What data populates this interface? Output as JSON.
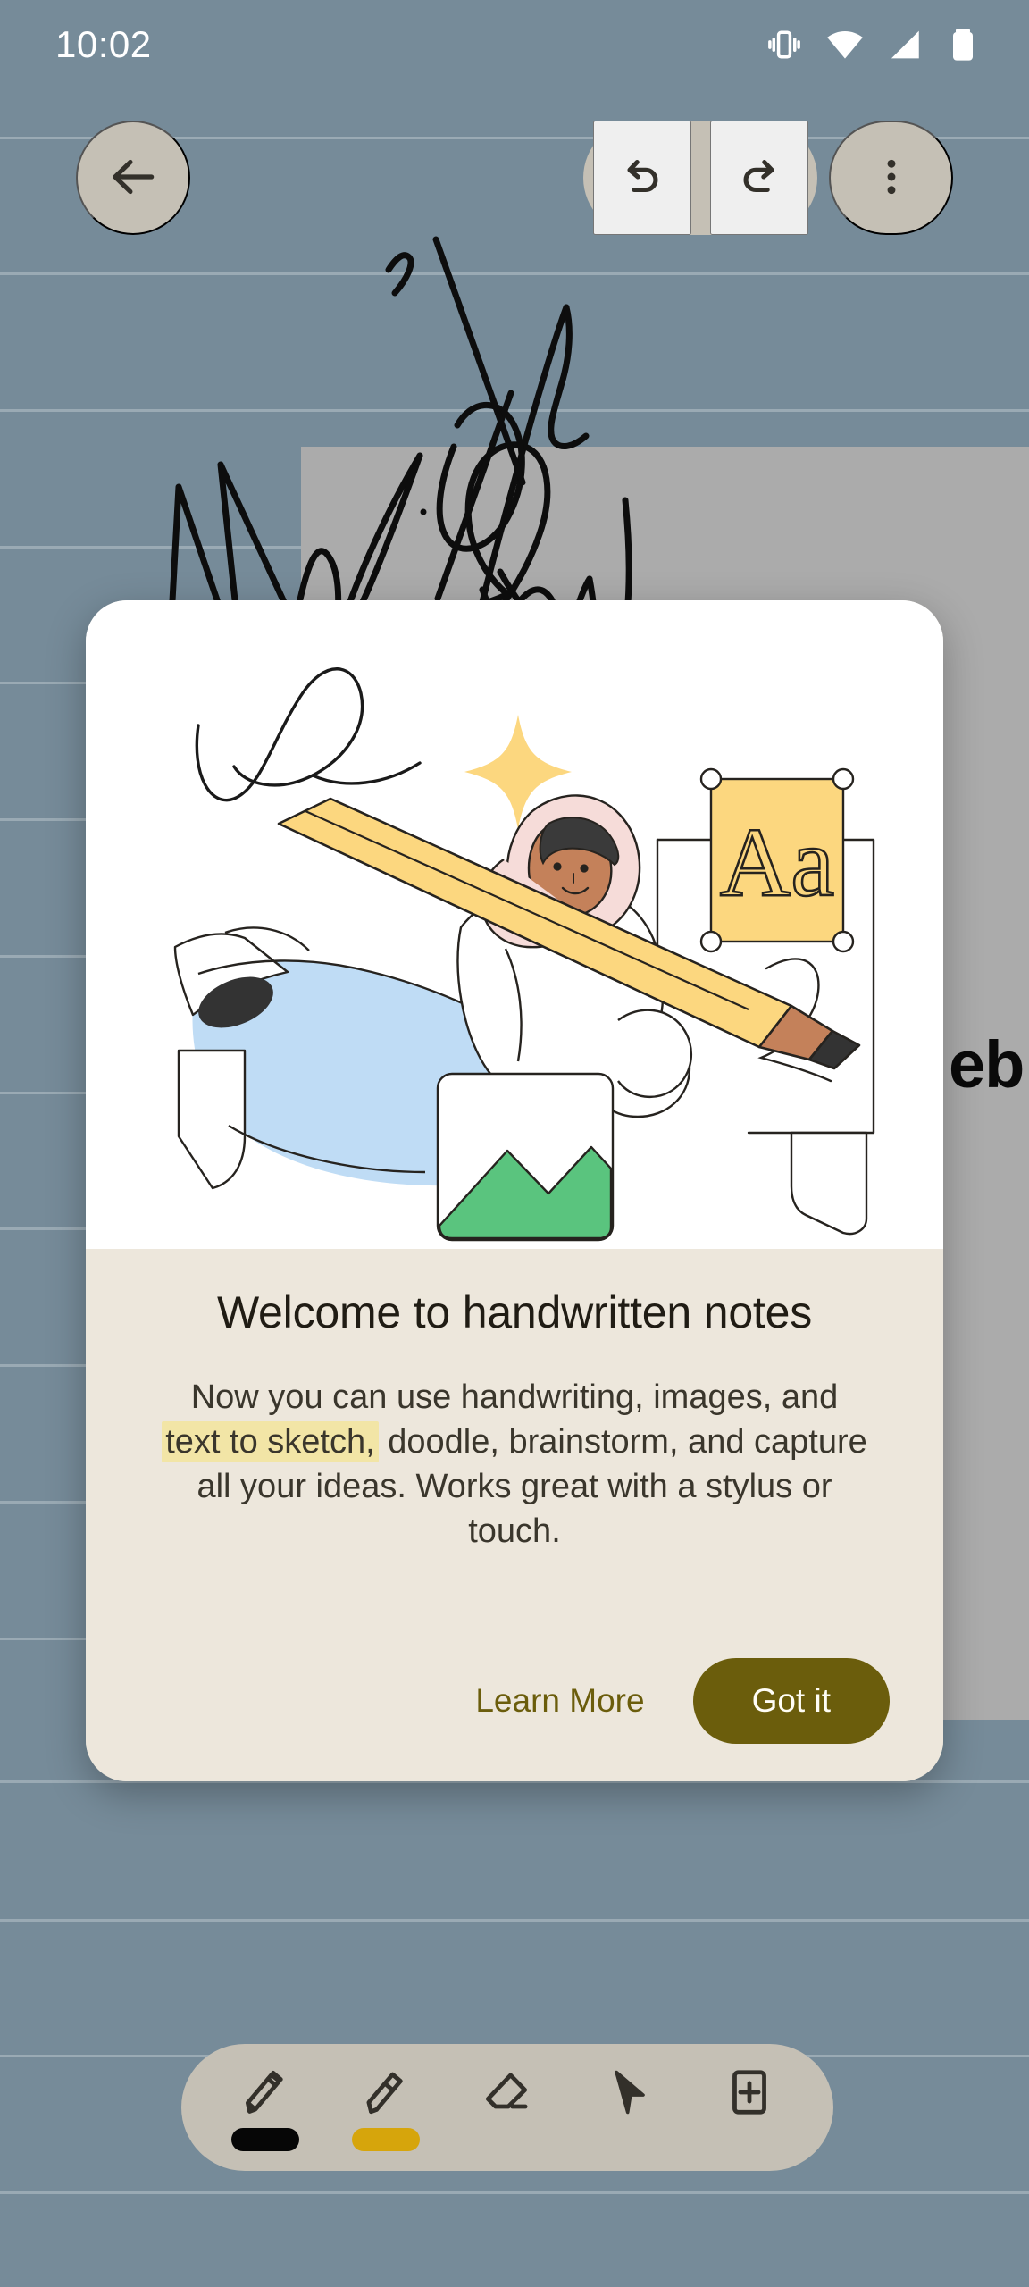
{
  "status_bar": {
    "time": "10:02",
    "icons": [
      {
        "name": "vibrate-icon",
        "label": "Vibrate mode"
      },
      {
        "name": "wifi-icon",
        "label": "Wi-Fi"
      },
      {
        "name": "cellular-signal-icon",
        "label": "Cellular signal"
      },
      {
        "name": "battery-icon",
        "label": "Battery"
      }
    ]
  },
  "top_toolbar": {
    "back_label": "Back",
    "undo_label": "Undo",
    "redo_label": "Redo",
    "more_label": "More options"
  },
  "canvas": {
    "background_color": "#768b99",
    "rule_line_color": "#9aaab4",
    "card_color": "#ababab",
    "ink_color": "#0d0d0d",
    "handwriting_text": "Android",
    "partial_text": "eb",
    "rule_line_positions": [
      153,
      305,
      458,
      611,
      763,
      916,
      1069,
      1222,
      1374,
      1527,
      1680,
      1833,
      1993,
      2148,
      2300,
      2453
    ]
  },
  "dialog": {
    "title": "Welcome to handwritten notes",
    "description_parts": [
      {
        "text": "Now you can use handwriting, images, and ",
        "highlight": false
      },
      {
        "text": "text to sketch,",
        "highlight": true
      },
      {
        "text": " doodle, brainstorm, and capture all your ideas. Works great with a stylus or touch.",
        "highlight": false
      }
    ],
    "learn_more_label": "Learn More",
    "got_it_label": "Got it",
    "surface_color": "#ede7dc",
    "illustration_bg": "#ffffff",
    "accent_color": "#6b5d0c",
    "highlight_color": "#f2e5a6",
    "illustration": {
      "name": "handwritten-notes-illustration",
      "description": "Person wearing a hijab riding a large yellow pencil across the canvas",
      "elements": [
        {
          "name": "doodle-squiggle",
          "color": "#1a1a1a"
        },
        {
          "name": "sparkle-star",
          "color": "#fcd77f"
        },
        {
          "name": "pencil",
          "color": "#fcd77f"
        },
        {
          "name": "person-dress",
          "color": "#bfdcf5"
        },
        {
          "name": "person-hijab",
          "color": "#f6dcd9"
        },
        {
          "name": "person-skin",
          "color": "#c4815a"
        },
        {
          "name": "text-box-aa",
          "label": "Aa",
          "color": "#fcd77f"
        },
        {
          "name": "image-placeholder",
          "color": "#5ac47e"
        },
        {
          "name": "paper-sheet",
          "color": "#ffffff"
        }
      ]
    }
  },
  "tool_palette": {
    "tools": [
      {
        "name": "pen-tool",
        "label": "Pen",
        "swatch_color": "#060606",
        "selected": true
      },
      {
        "name": "highlighter-tool",
        "label": "Highlighter",
        "swatch_color": "#d6a50c",
        "selected": false
      },
      {
        "name": "eraser-tool",
        "label": "Eraser",
        "swatch_color": null,
        "selected": false
      },
      {
        "name": "select-tool",
        "label": "Select",
        "swatch_color": null,
        "selected": false
      },
      {
        "name": "insert-tool",
        "label": "Insert",
        "swatch_color": null,
        "selected": false
      }
    ],
    "background_color": "#c5c0b5",
    "icon_color": "#33302a"
  }
}
